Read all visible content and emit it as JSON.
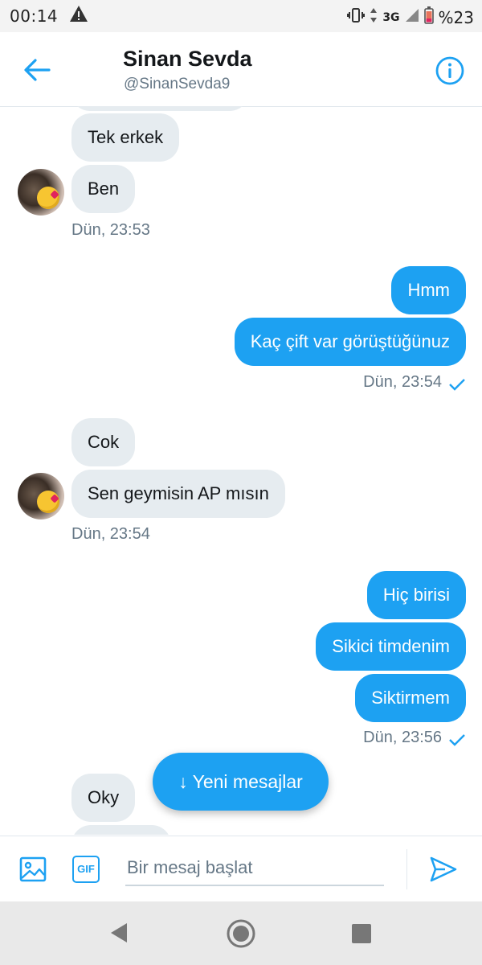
{
  "status_bar": {
    "time": "00:14",
    "network": "3G",
    "battery": "%23",
    "icons": [
      "warning-icon",
      "vibrate-icon",
      "data-arrows-icon",
      "signal-icon",
      "battery-icon"
    ]
  },
  "header": {
    "name": "Sinan Sevda",
    "handle": "@SinanSevda9",
    "back_icon": "arrow-left-icon",
    "info_icon": "info-icon"
  },
  "conversation": [
    {
      "kind": "in",
      "text": "Tek erkek"
    },
    {
      "kind": "in",
      "text": "Ben"
    },
    {
      "kind": "timestamp_in",
      "text": "Dün, 23:53"
    },
    {
      "kind": "out",
      "text": "Hmm"
    },
    {
      "kind": "out",
      "text": "Kaç çift var görüştüğünuz"
    },
    {
      "kind": "timestamp_out",
      "text": "Dün, 23:54"
    },
    {
      "kind": "in",
      "text": "Cok"
    },
    {
      "kind": "in",
      "text": "Sen geymisin AP mısın"
    },
    {
      "kind": "timestamp_in",
      "text": "Dün, 23:54"
    },
    {
      "kind": "out",
      "text": "Hiç birisi"
    },
    {
      "kind": "out",
      "text": "Sikici timdenim"
    },
    {
      "kind": "out",
      "text": "Siktirmem"
    },
    {
      "kind": "timestamp_out",
      "text": "Dün, 23:56"
    },
    {
      "kind": "in",
      "text": "Oky"
    }
  ],
  "new_messages_button": {
    "label": "↓ Yeni mesajlar"
  },
  "composer": {
    "placeholder": "Bir mesaj başlat",
    "value": "",
    "gif_label": "GIF",
    "icons": [
      "image-icon",
      "gif-icon",
      "send-icon"
    ]
  },
  "colors": {
    "accent": "#1da1f2",
    "incoming_bubble": "#e6ecf0",
    "timestamp": "#657786"
  }
}
